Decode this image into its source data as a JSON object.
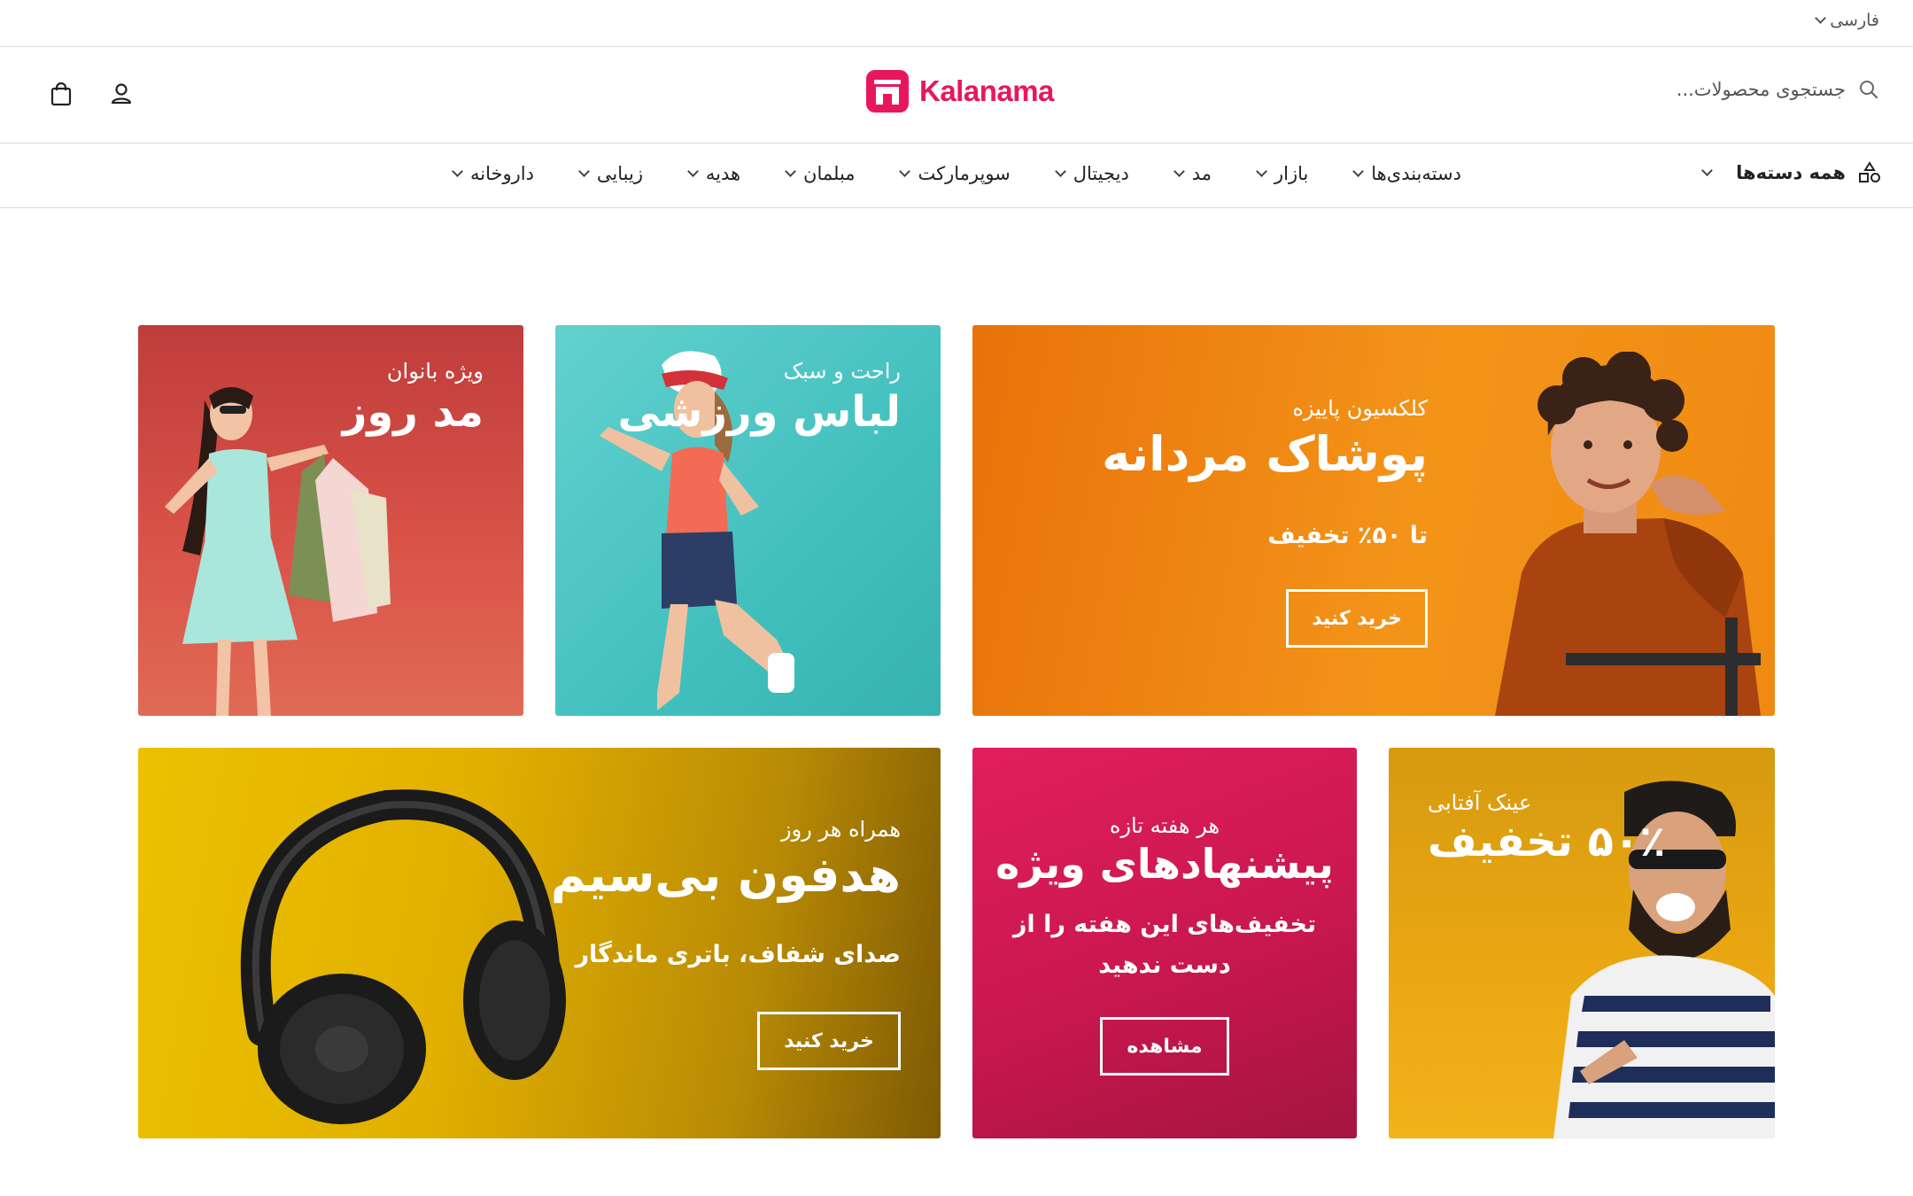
{
  "topbar": {
    "language": "فارسی"
  },
  "header": {
    "search_placeholder": "جستجوی محصولات...",
    "logo_text": "Kalanama",
    "brand_color": "#e8175d"
  },
  "nav": {
    "all_categories": "همه دسته‌ها",
    "items": [
      {
        "label": "دسته‌بندی‌ها"
      },
      {
        "label": "بازار"
      },
      {
        "label": "مد"
      },
      {
        "label": "دیجیتال"
      },
      {
        "label": "سوپرمارکت"
      },
      {
        "label": "مبلمان"
      },
      {
        "label": "هدیه"
      },
      {
        "label": "زیبایی"
      },
      {
        "label": "داروخانه"
      }
    ]
  },
  "banners": {
    "mens": {
      "small": "کلکسیون پاییزه",
      "title": "پوشاک مردانه",
      "sub": "تا ۵۰٪ تخفیف",
      "button": "خرید کنید",
      "color": "#f08b16"
    },
    "sport": {
      "small": "راحت و سبک",
      "title": "لباس ورزشی",
      "color": "#4cc4c2"
    },
    "women": {
      "small": "ویژه بانوان",
      "title": "مد روز",
      "color": "#d9544a"
    },
    "sunglasses": {
      "small": "عینک آفتابی",
      "title": "۵۰٪ تخفیف",
      "color": "#e6a80e"
    },
    "weekly": {
      "small": "هر هفته تازه",
      "title": "پیشنهادهای ویژه",
      "sub_line1": "تخفیف‌های این هفته را از",
      "sub_line2": "دست ندهید",
      "button": "مشاهده",
      "color": "#cc1850"
    },
    "headphones": {
      "small": "همراه هر روز",
      "title": "هدفون بی‌سیم",
      "sub": "صدای شفاف، باتری ماندگار",
      "button": "خرید کنید",
      "color": "#e8b400"
    }
  }
}
